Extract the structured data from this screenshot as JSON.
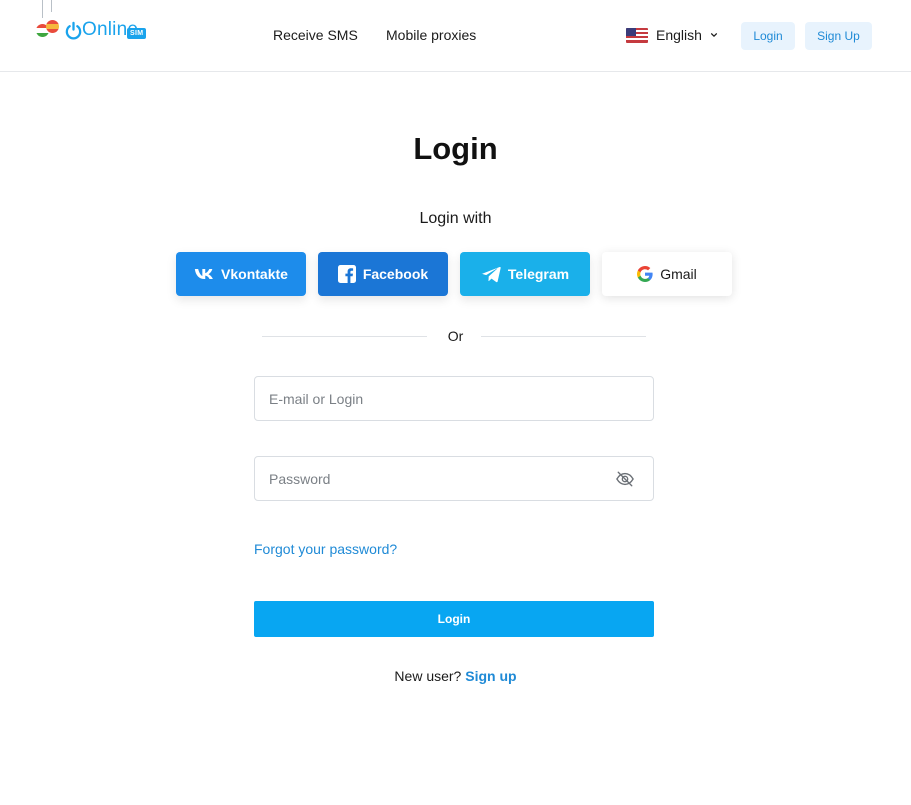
{
  "header": {
    "logo": {
      "brand": "Online",
      "badge": "SIM"
    },
    "nav": {
      "receive_sms": "Receive SMS",
      "mobile_proxies": "Mobile proxies"
    },
    "language": {
      "label": "English",
      "flag": "us-flag-icon",
      "chevron": "chevron-down-icon"
    },
    "login_button": "Login",
    "signup_button": "Sign Up"
  },
  "main": {
    "title": "Login",
    "login_with": "Login with",
    "social": {
      "vk": {
        "label": "Vkontakte",
        "icon": "vk-icon"
      },
      "facebook": {
        "label": "Facebook",
        "icon": "facebook-icon"
      },
      "telegram": {
        "label": "Telegram",
        "icon": "telegram-icon"
      },
      "gmail": {
        "label": "Gmail",
        "icon": "google-icon"
      }
    },
    "or_text": "Or",
    "email_field": {
      "placeholder": "E-mail or Login",
      "value": ""
    },
    "password_field": {
      "placeholder": "Password",
      "value": "",
      "icon": "eye-hidden-icon"
    },
    "forgot_link": "Forgot your password?",
    "login_button": "Login",
    "new_user_text": "New user?",
    "signup_link": "Sign up"
  },
  "colors": {
    "accent": "#08a6f2",
    "link": "#1f8ad6",
    "vk": "#1d8ceb",
    "facebook": "#1b76d6",
    "telegram": "#1ab0ea",
    "header_button_bg": "#e8f3fd"
  }
}
